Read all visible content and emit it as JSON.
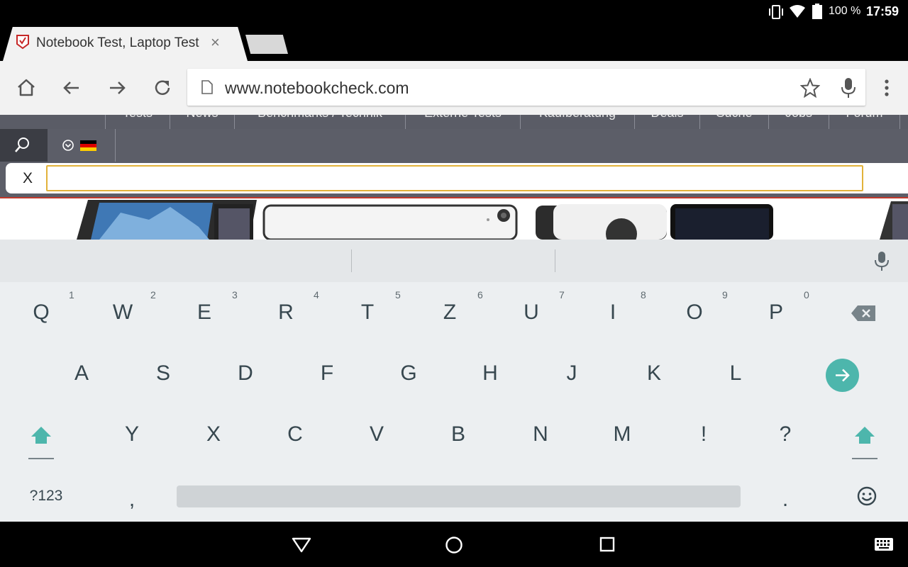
{
  "status_bar": {
    "battery_percent": "100 %",
    "time": "17:59"
  },
  "tab": {
    "title": "Notebook Test, Laptop Test",
    "close_label": "×"
  },
  "toolbar": {
    "url": "www.notebookcheck.com"
  },
  "site_nav": {
    "items": [
      "Tests",
      "News",
      "Benchmarks / Technik",
      "Externe Tests",
      "Kaufberatung",
      "Deals",
      "Suche",
      "Jobs",
      "Forum"
    ]
  },
  "site_search": {
    "close_label": "X",
    "value": ""
  },
  "keyboard": {
    "row1": [
      {
        "k": "Q",
        "h": "1"
      },
      {
        "k": "W",
        "h": "2"
      },
      {
        "k": "E",
        "h": "3"
      },
      {
        "k": "R",
        "h": "4"
      },
      {
        "k": "T",
        "h": "5"
      },
      {
        "k": "Z",
        "h": "6"
      },
      {
        "k": "U",
        "h": "7"
      },
      {
        "k": "I",
        "h": "8"
      },
      {
        "k": "O",
        "h": "9"
      },
      {
        "k": "P",
        "h": "0"
      }
    ],
    "row2": [
      "A",
      "S",
      "D",
      "F",
      "G",
      "H",
      "J",
      "K",
      "L"
    ],
    "row3": [
      "Y",
      "X",
      "C",
      "V",
      "B",
      "N",
      "M",
      "!",
      "?"
    ],
    "symbols_label": "?123",
    "comma": ",",
    "period": ".",
    "accent_color": "#4db6ac"
  }
}
